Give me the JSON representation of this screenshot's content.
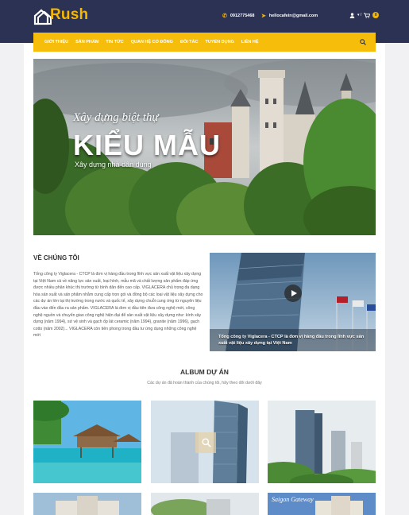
{
  "brand": {
    "name": "Rush",
    "color": "#f5b700",
    "nav_color": "#2b3253"
  },
  "header": {
    "phone": "0912775468",
    "email": "hellocafein@gmail.com",
    "user_caret": "▾ /",
    "cart_count": "0"
  },
  "nav": {
    "items": [
      "GIỚI THIỆU",
      "SẢN PHẨM",
      "TIN TỨC",
      "QUAN HỆ CỔ ĐÔNG",
      "ĐỐI TÁC",
      "TUYỂN DỤNG",
      "LIÊN HỆ"
    ],
    "bar_color": "#f6bd0a"
  },
  "hero": {
    "line1": "Xây dựng biệt thự",
    "line2": "KIỂU MẪU",
    "line3": "Xây dựng nhà dân dụng"
  },
  "about": {
    "title": "VỀ CHÚNG TÔI",
    "body": "Tổng công ty Viglacera - CTCP là đơn vị hàng đầu trong lĩnh vực sản xuất vật liệu xây dựng tại Việt Nam cả về năng lực sản xuất, loại hình, mẫu mã và chất lượng sản phẩm đáp ứng được nhiều phân khúc thị trường từ bình dân đến cao cấp. VIGLACERA chủ trọng đa dạng hóa sản xuất và sản phẩm nhằm cung cấp trọn gói và đồng bộ các loại vật liệu xây dựng cho các dự án lớn tại thị trường trong nước và quốc tế, xây dựng chuỗi cung ứng từ nguyên liệu đầu vào đến đầu ra sản phẩm. VIGLACERA là đơn vị đầu tiên đưa công nghệ mới, công nghệ nguồn và chuyển giao công nghệ hiện đại để sản xuất vật liệu xây dựng như: kính xây dựng (năm 1994), sứ vệ sinh và gạch ốp lát ceramic (năm 1994), granite (năm 1996), gạch cotto (năm 2002)... VIGLACERA còn tiên phong trong đầu tư ứng dụng những công nghệ mới",
    "video_caption": "Tổng công ty Viglacera - CTCP là đơn vị hàng đầu trong lĩnh vực sản xuất vật liệu xây dựng tại Việt Nam"
  },
  "album": {
    "title": "ALBUM DỰ ÁN",
    "subtitle": "Các dự án đã hoàn thành của chúng tôi, hãy theo dõi dưới đây",
    "sign_text": "Saigon Gateway"
  }
}
